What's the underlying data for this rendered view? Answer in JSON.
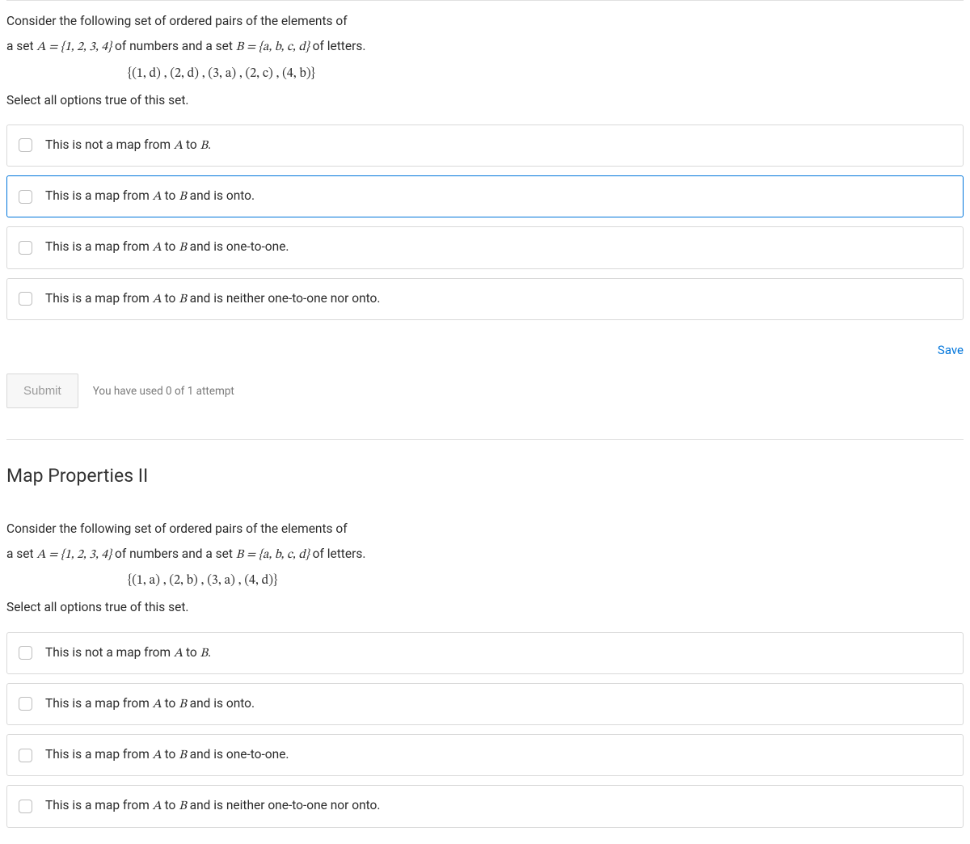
{
  "question1": {
    "line1_pre": "Consider the following set of ordered pairs of the elements of",
    "line2_pre": "a set  ",
    "setA": "A = {1, 2, 3, 4}",
    "line2_mid": "  of numbers and a set  ",
    "setB": "B = {a, b, c, d}",
    "line2_post": "  of letters.",
    "pairs": "{(1, d) , (2, d) , (3, a) , (2, c) , (4, b)}",
    "instruction": "Select all options true of this set.",
    "options": [
      {
        "pre": "This is not a map from ",
        "A": "A",
        "mid": " to ",
        "B": "B",
        "post": "."
      },
      {
        "pre": "This is a map from ",
        "A": "A",
        "mid": " to ",
        "B": "B",
        "post": " and is onto."
      },
      {
        "pre": "This is a map from ",
        "A": "A",
        "mid": " to ",
        "B": "B",
        "post": " and is one-to-one."
      },
      {
        "pre": "This is a map from ",
        "A": "A",
        "mid": " to ",
        "B": "B",
        "post": " and is neither one-to-one nor onto."
      }
    ],
    "focused_option": 1,
    "save_label": "Save",
    "submit_label": "Submit",
    "attempts_text": "You have used 0 of 1 attempt"
  },
  "question2": {
    "title": "Map Properties II",
    "line1_pre": "Consider the following set of ordered pairs of the elements of",
    "line2_pre": "a set  ",
    "setA": "A = {1, 2, 3, 4}",
    "line2_mid": "  of numbers and a set  ",
    "setB": "B = {a, b, c, d}",
    "line2_post": "  of letters.",
    "pairs": "{(1, a) , (2, b) , (3, a) , (4, d)}",
    "instruction": "Select all options true of this set.",
    "options": [
      {
        "pre": "This is not a map from ",
        "A": "A",
        "mid": " to ",
        "B": "B",
        "post": "."
      },
      {
        "pre": "This is a map from ",
        "A": "A",
        "mid": " to ",
        "B": "B",
        "post": " and is onto."
      },
      {
        "pre": "This is a map from ",
        "A": "A",
        "mid": " to ",
        "B": "B",
        "post": " and is one-to-one."
      },
      {
        "pre": "This is a map from ",
        "A": "A",
        "mid": " to ",
        "B": "B",
        "post": " and is neither one-to-one nor onto."
      }
    ]
  }
}
